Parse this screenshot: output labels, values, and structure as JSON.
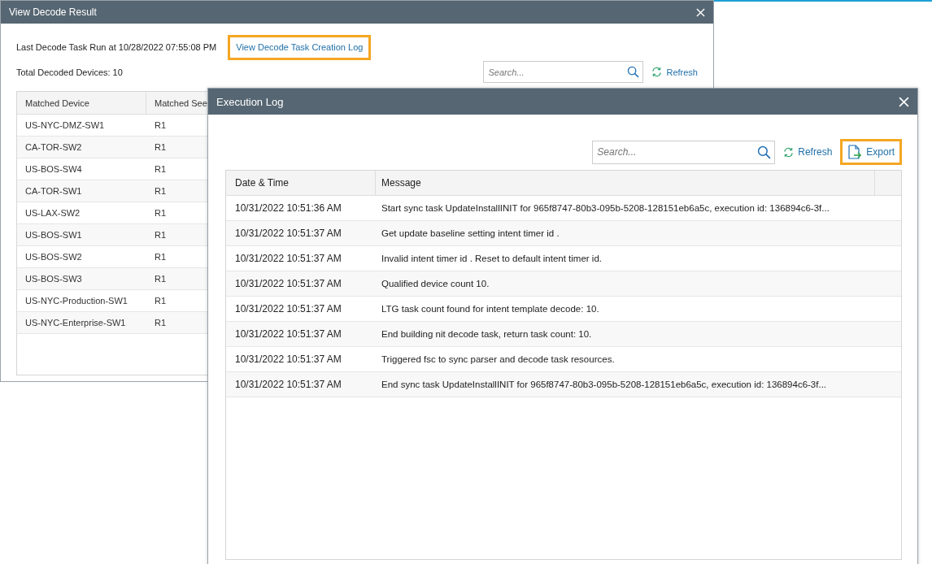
{
  "decode_dialog": {
    "title": "View Decode Result",
    "last_run": "Last Decode Task Run at 10/28/2022 07:55:08 PM",
    "creation_log_link": {
      "label": "View Decode Task Creation Log",
      "highlighted": true
    },
    "total": "Total Decoded Devices: 10",
    "search": {
      "placeholder": "Search..."
    },
    "refresh": "Refresh",
    "table": {
      "columns": [
        "Matched Device",
        "Matched See"
      ],
      "rows": [
        [
          "US-NYC-DMZ-SW1",
          "R1"
        ],
        [
          "CA-TOR-SW2",
          "R1"
        ],
        [
          "US-BOS-SW4",
          "R1"
        ],
        [
          "CA-TOR-SW1",
          "R1"
        ],
        [
          "US-LAX-SW2",
          "R1"
        ],
        [
          "US-BOS-SW1",
          "R1"
        ],
        [
          "US-BOS-SW2",
          "R1"
        ],
        [
          "US-BOS-SW3",
          "R1"
        ],
        [
          "US-NYC-Production-SW1",
          "R1"
        ],
        [
          "US-NYC-Enterprise-SW1",
          "R1"
        ]
      ]
    }
  },
  "execution_log": {
    "title": "Execution Log",
    "search": {
      "placeholder": "Search..."
    },
    "refresh": "Refresh",
    "export": {
      "label": "Export",
      "highlighted": true
    },
    "table": {
      "columns": [
        "Date & Time",
        "Message"
      ],
      "rows": [
        [
          "10/31/2022 10:51:36 AM",
          "Start sync task UpdateInstallINIT for 965f8747-80b3-095b-5208-128151eb6a5c, execution id: 136894c6-3f..."
        ],
        [
          "10/31/2022 10:51:37 AM",
          "Get update baseline setting intent timer id ."
        ],
        [
          "10/31/2022 10:51:37 AM",
          "Invalid intent timer id . Reset to default intent timer id."
        ],
        [
          "10/31/2022 10:51:37 AM",
          "Qualified device count 10."
        ],
        [
          "10/31/2022 10:51:37 AM",
          "LTG task count found for intent template decode: 10."
        ],
        [
          "10/31/2022 10:51:37 AM",
          "End building nit decode task, return task count: 10."
        ],
        [
          "10/31/2022 10:51:37 AM",
          "Triggered fsc to sync parser and decode task resources."
        ],
        [
          "10/31/2022 10:51:37 AM",
          "End sync task UpdateInstallINIT for 965f8747-80b3-095b-5208-128151eb6a5c, execution id: 136894c6-3f..."
        ]
      ]
    }
  }
}
